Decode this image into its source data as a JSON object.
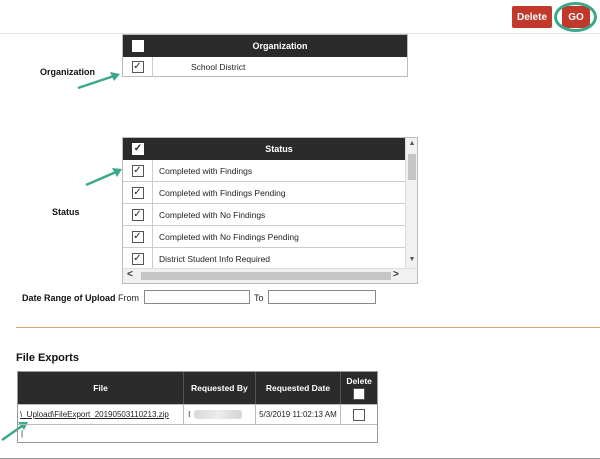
{
  "toolbar": {
    "delete_label": "Delete",
    "go_label": "GO"
  },
  "organization": {
    "label": "Organization",
    "header": "Organization",
    "rows": [
      {
        "checked": true,
        "name": "School District"
      }
    ]
  },
  "status": {
    "label": "Status",
    "header": "Status",
    "rows": [
      {
        "checked": true,
        "name": "Completed with Findings"
      },
      {
        "checked": true,
        "name": "Completed with Findings Pending"
      },
      {
        "checked": true,
        "name": "Completed with No Findings"
      },
      {
        "checked": true,
        "name": "Completed with No Findings Pending"
      },
      {
        "checked": true,
        "name": "District Student Info Required"
      }
    ]
  },
  "date_range": {
    "label": "Date Range of Upload",
    "from_label": "From",
    "to_label": "To",
    "from_value": "",
    "to_value": ""
  },
  "file_exports": {
    "title": "File Exports",
    "columns": {
      "file": "File",
      "requested_by": "Requested By",
      "requested_date": "Requested Date",
      "delete": "Delete"
    },
    "rows": [
      {
        "file": "\\_Upload\\FileExport_20190503110213.zip",
        "requested_by": "I",
        "requested_date": "5/3/2019 11:02:13 AM",
        "delete_checked": false
      }
    ],
    "footer_text": "|"
  },
  "colors": {
    "accent": "#c0392b",
    "header": "#2b2b2b",
    "annotation": "#3aa88a"
  },
  "icons": {
    "checkbox_checked": "✓",
    "scroll_up": "▲",
    "scroll_down": "▼",
    "scroll_left": "<",
    "scroll_right": ">"
  }
}
